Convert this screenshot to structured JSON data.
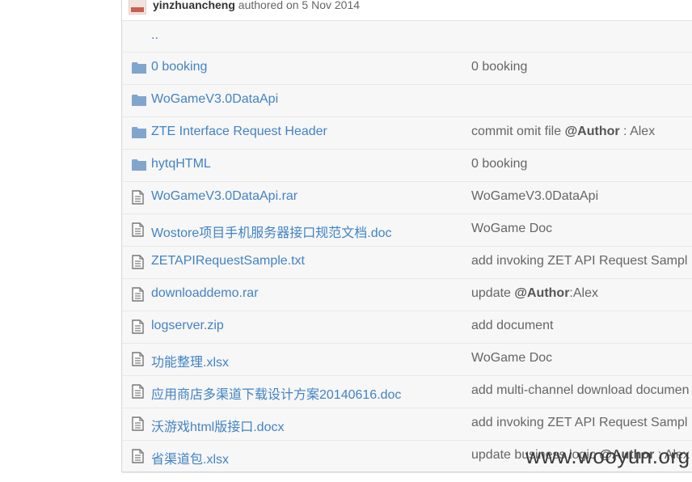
{
  "commit": {
    "author": "yinzhuancheng",
    "suffix": " authored on 5 Nov 2014"
  },
  "parent_dir": {
    "label": ".."
  },
  "files": [
    {
      "type": "folder",
      "name": "0 booking",
      "message": [
        {
          "t": "0 booking"
        }
      ]
    },
    {
      "type": "folder",
      "name": "WoGameV3.0DataApi",
      "message": []
    },
    {
      "type": "folder",
      "name": "ZTE Interface Request Header",
      "message": [
        {
          "t": "commit omit file "
        },
        {
          "t": "@Author",
          "b": true
        },
        {
          "t": " : Alex"
        }
      ]
    },
    {
      "type": "folder",
      "name": "hytqHTML",
      "message": [
        {
          "t": "0 booking"
        }
      ]
    },
    {
      "type": "file",
      "name": "WoGameV3.0DataApi.rar",
      "message": [
        {
          "t": "WoGameV3.0DataApi"
        }
      ]
    },
    {
      "type": "file",
      "name": "Wostore项目手机服务器接口规范文档.doc",
      "message": [
        {
          "t": "WoGame Doc"
        }
      ]
    },
    {
      "type": "file",
      "name": "ZETAPIRequestSample.txt",
      "message": [
        {
          "t": "add invoking ZET API Request Sampl"
        }
      ]
    },
    {
      "type": "file",
      "name": "downloaddemo.rar",
      "message": [
        {
          "t": "update "
        },
        {
          "t": "@Author",
          "b": true
        },
        {
          "t": ":Alex"
        }
      ]
    },
    {
      "type": "file",
      "name": "logserver.zip",
      "message": [
        {
          "t": "add document"
        }
      ]
    },
    {
      "type": "file",
      "name": "功能整理.xlsx",
      "message": [
        {
          "t": "WoGame Doc"
        }
      ]
    },
    {
      "type": "file",
      "name": "应用商店多渠道下载设计方案20140616.doc",
      "message": [
        {
          "t": "add multi-channel download documen"
        }
      ]
    },
    {
      "type": "file",
      "name": "沃游戏html版接口.docx",
      "message": [
        {
          "t": "add invoking ZET API Request Sampl"
        }
      ]
    },
    {
      "type": "file",
      "name": "省渠道包.xlsx",
      "message": [
        {
          "t": "update business logic "
        },
        {
          "t": "@Author",
          "b": true
        },
        {
          "t": " : Alex"
        }
      ]
    }
  ],
  "watermark": "www.wooyun.org",
  "colors": {
    "link": "#4183c4",
    "folder_icon": "#80a6cd",
    "file_icon": "#777777"
  }
}
